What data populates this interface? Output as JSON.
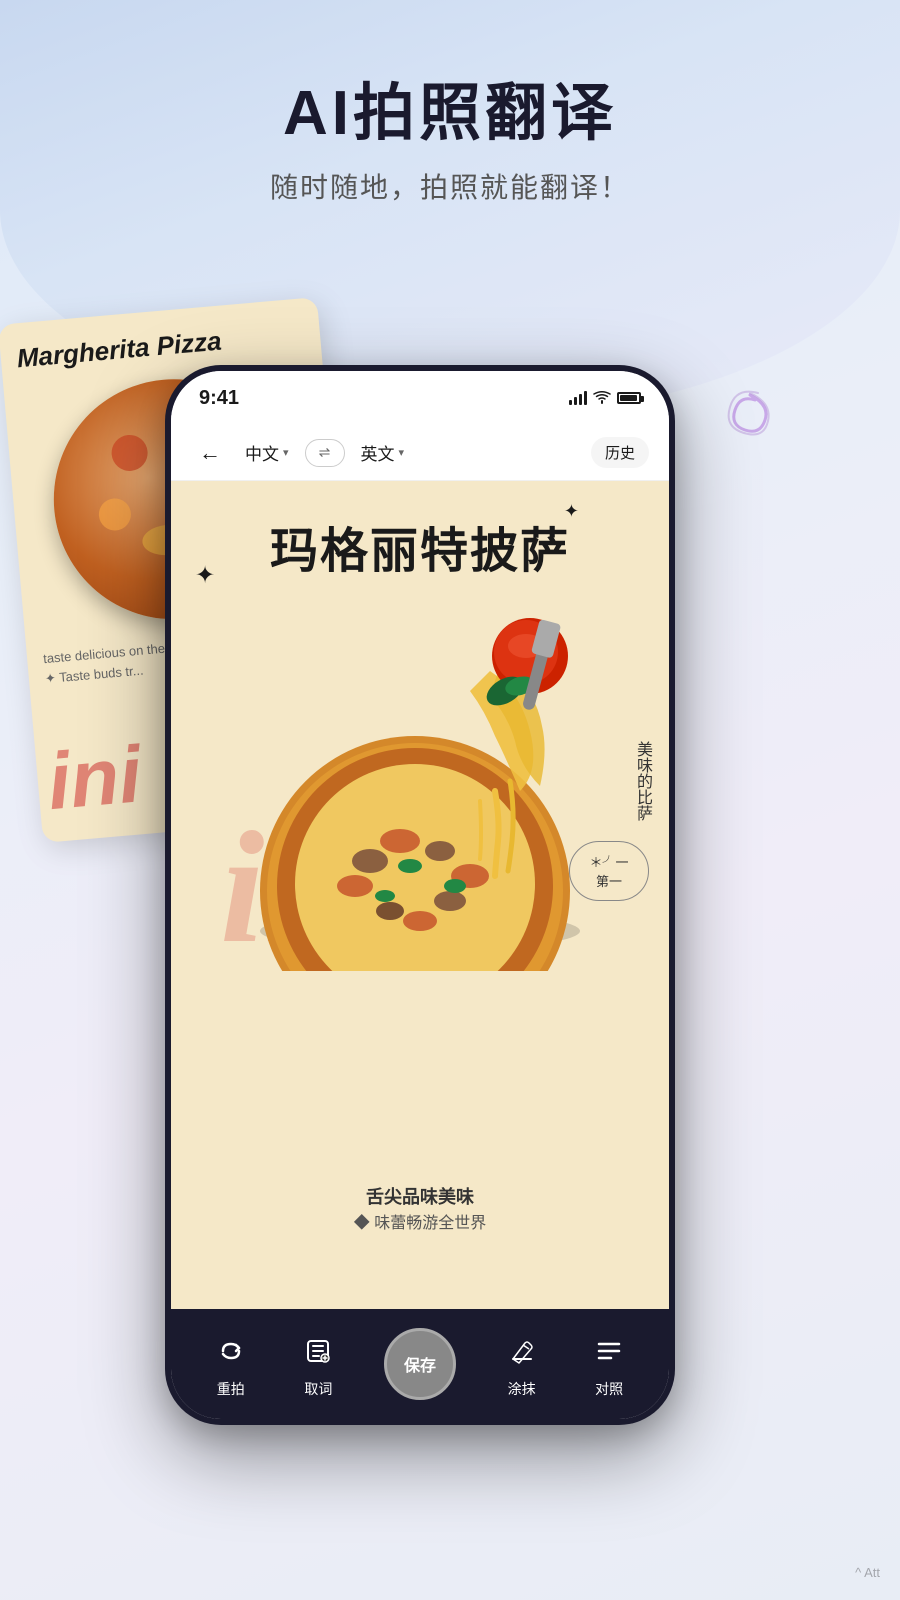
{
  "header": {
    "title": "AI拍照翻译",
    "subtitle": "随时随地，拍照就能翻译！"
  },
  "bg_card": {
    "title": "Margherita Pizza",
    "text1": "taste delicious on the tip o",
    "text2": "✦  Taste buds tr..."
  },
  "phone": {
    "status_bar": {
      "time": "9:41",
      "signal": "full",
      "wifi": "on",
      "battery": "full"
    },
    "nav": {
      "back_icon": "←",
      "source_lang": "中文",
      "target_lang": "英文",
      "swap_icon": "⇌",
      "history_label": "历史"
    },
    "content": {
      "pizza_title": "玛格丽特披萨",
      "side_text": "美味的比萨",
      "badge_text_line1": "＊╯一",
      "badge_text_line2": "第一",
      "bottom_text1": "舌尖品味美味",
      "bottom_text2": "◆  味蕾畅游全世界"
    },
    "toolbar": {
      "retake_icon": "↩",
      "retake_label": "重拍",
      "extract_icon": "⊞",
      "extract_label": "取词",
      "save_label": "保存",
      "erase_icon": "✏",
      "erase_label": "涂抹",
      "compare_icon": "≡",
      "compare_label": "对照"
    }
  },
  "deco": {
    "swirl_color": "#c8a8e8"
  },
  "colors": {
    "background_start": "#dce8f8",
    "background_end": "#e8edf5",
    "phone_body": "#1a1a2e",
    "pizza_bg": "#f5e8c8"
  }
}
